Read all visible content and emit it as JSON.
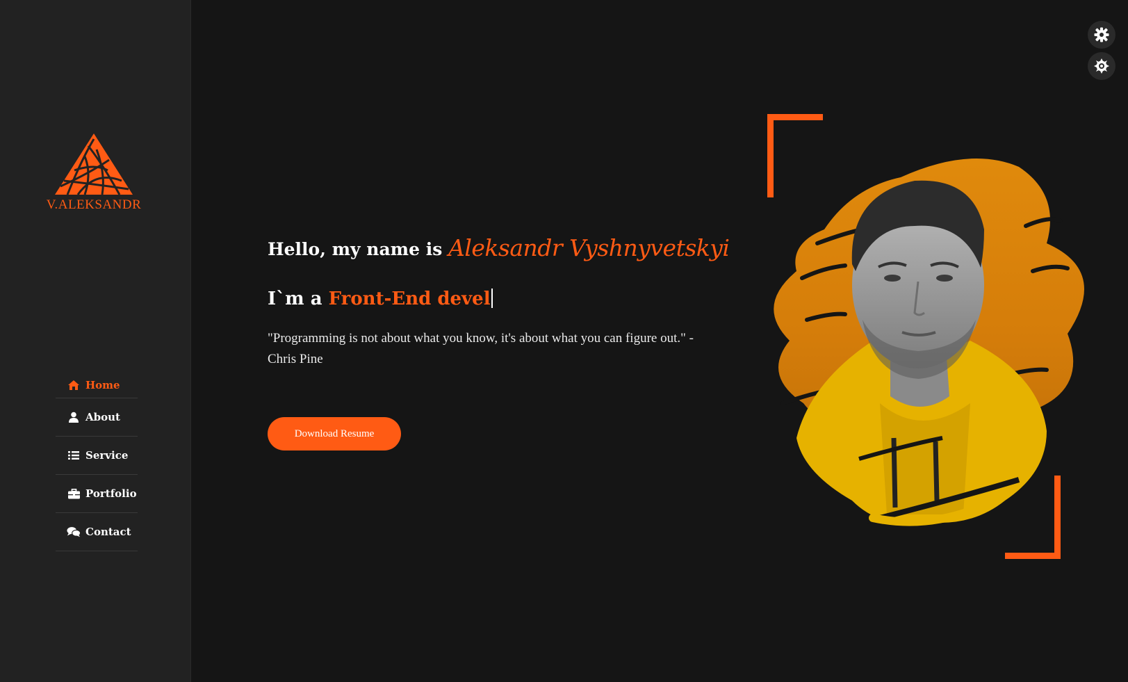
{
  "colors": {
    "accent": "#ff5b14",
    "background": "#151515",
    "sidebar": "#222222",
    "blob_orange": "#e08a0c",
    "hoodie_yellow": "#e8b400"
  },
  "logo": {
    "icon": "triangle-mesh-logo",
    "text": "V.ALEKSANDR"
  },
  "nav": {
    "items": [
      {
        "label": "Home",
        "icon": "home-icon",
        "active": true
      },
      {
        "label": "About",
        "icon": "user-icon",
        "active": false
      },
      {
        "label": "Service",
        "icon": "list-icon",
        "active": false
      },
      {
        "label": "Portfolio",
        "icon": "briefcase-icon",
        "active": false
      },
      {
        "label": "Contact",
        "icon": "chat-bubbles-icon",
        "active": false
      }
    ]
  },
  "hero": {
    "greeting": "Hello, my name is",
    "name": "Aleksandr Vyshnyvetskyi",
    "role_prefix": "I`m a",
    "role_typed": "Front-End devel",
    "quote_line1": "\"Programming is not about what you know, it's about what you can figure out.\" -",
    "quote_line2": "Chris Pine",
    "button_label": "Download Resume"
  },
  "settings": {
    "buttons": [
      {
        "icon": "gear-icon"
      },
      {
        "icon": "theme-toggle-gear-icon"
      }
    ]
  },
  "portrait": {
    "alt": "portrait-photo"
  }
}
